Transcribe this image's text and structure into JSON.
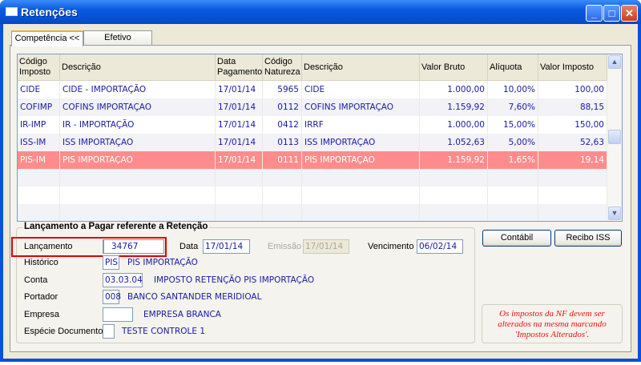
{
  "window": {
    "title": "Retenções"
  },
  "tabs": [
    {
      "label": "Competência <<",
      "active": true
    },
    {
      "label": "Efetivo",
      "active": false
    }
  ],
  "grid": {
    "headers": [
      "Código Imposto",
      "Descrição",
      "Data Pagamento",
      "Código Natureza",
      "Descrição",
      "Valor Bruto",
      "Alíquota",
      "Valor Imposto"
    ],
    "rows": [
      [
        "CIDE",
        "CIDE - IMPORTAÇÃO",
        "17/01/14",
        "5965",
        "CIDE",
        "1.000,00",
        "10,00%",
        "100,00"
      ],
      [
        "COFIMP",
        "COFINS IMPORTAÇAO",
        "17/01/14",
        "0112",
        "COFINS IMPORTAÇAO",
        "1.159,92",
        "7,60%",
        "88,15"
      ],
      [
        "IR-IMP",
        "IR - IMPORTAÇÃO",
        "17/01/14",
        "0412",
        "IRRF",
        "1.000,00",
        "15,00%",
        "150,00"
      ],
      [
        "ISS-IM",
        "ISS IMPORTAÇAO",
        "17/01/14",
        "0113",
        "ISS IMPORTAÇAO",
        "1.052,63",
        "5,00%",
        "52,63"
      ],
      [
        "PIS-IM",
        "PIS IMPORTAÇAO",
        "17/01/14",
        "0111",
        "PIS IMPORTAÇAO",
        "1.159,92",
        "1,65%",
        "19,14"
      ]
    ],
    "selected_row": 4
  },
  "form": {
    "group_title": "Lançamento a Pagar referente a Retenção",
    "lancamento": {
      "label": "Lançamento",
      "value": "34767"
    },
    "data": {
      "label": "Data",
      "value": "17/01/14"
    },
    "emissao": {
      "label": "Emissão",
      "value": "17/01/14"
    },
    "vencimento": {
      "label": "Vencimento",
      "value": "06/02/14"
    },
    "historico": {
      "label": "Histórico",
      "code": "PIS",
      "desc": "PIS IMPORTAÇÃO"
    },
    "conta": {
      "label": "Conta",
      "code": "03.03.04",
      "desc": "IMPOSTO RETENÇÃO PIS IMPORTAÇÃO"
    },
    "portador": {
      "label": "Portador",
      "code": "008",
      "desc": "BANCO SANTANDER MERIDIOAL"
    },
    "empresa": {
      "label": "Empresa",
      "code": "",
      "desc": "EMPRESA BRANCA"
    },
    "especie": {
      "label": "Espécie Documento",
      "code": "",
      "desc": "TESTE CONTROLE 1"
    }
  },
  "buttons": {
    "contabil": "Contábil",
    "recibo_iss": "Recibo ISS"
  },
  "note": "Os impostos da NF devem ser alterados na mesma marcando 'Impostos Alterados'."
}
